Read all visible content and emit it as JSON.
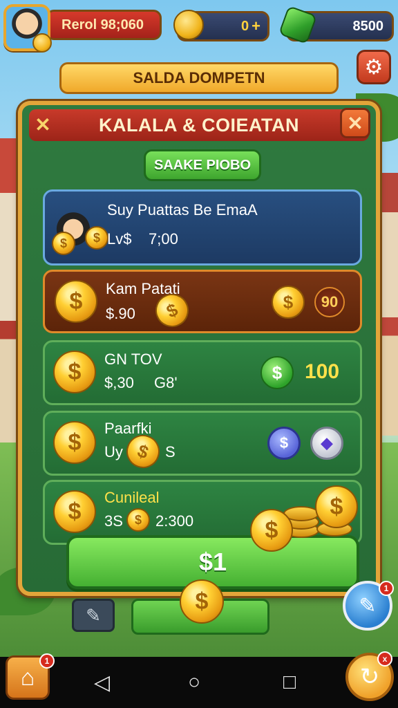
{
  "topbar": {
    "player_label": "Rerol 98;060",
    "coins": "0",
    "coin_plus": "+",
    "gems": "8500",
    "icons": [
      "avatar",
      "coin-icon",
      "gem-icon"
    ]
  },
  "wallet_title": "SALDA DOMPETN",
  "settings_icon": "gear-icon",
  "panel": {
    "title": "KALALA & COIEATAN",
    "close_left": "✕",
    "close_right": "✕",
    "top_button": "SAAKE PIOBO",
    "rows": [
      {
        "title": "Suy Puattas Be EmaA",
        "sub_a": "Lv$",
        "sub_b": "7;00"
      },
      {
        "title": "Kam Patati",
        "sub_a": "$.90",
        "badge": "90"
      },
      {
        "title": "GN TOV",
        "sub_a": "$,30",
        "sub_b": "G8'",
        "value": "100"
      },
      {
        "title": "Paarfki",
        "sub_a": "Uy",
        "sub_b": "S"
      },
      {
        "title": "Cunileal",
        "sub_a": "3S",
        "sub_b": "2:300"
      }
    ],
    "big_button": "$1"
  },
  "bottom": {
    "home_badge": "1",
    "fab_badge": "1",
    "refresh_badge": "x"
  },
  "colors": {
    "panel_green": "#2f7a3f",
    "frame_gold": "#e3a53a",
    "header_red": "#c83a2a",
    "button_green": "#45b032",
    "coin_gold": "#ffcf33"
  }
}
